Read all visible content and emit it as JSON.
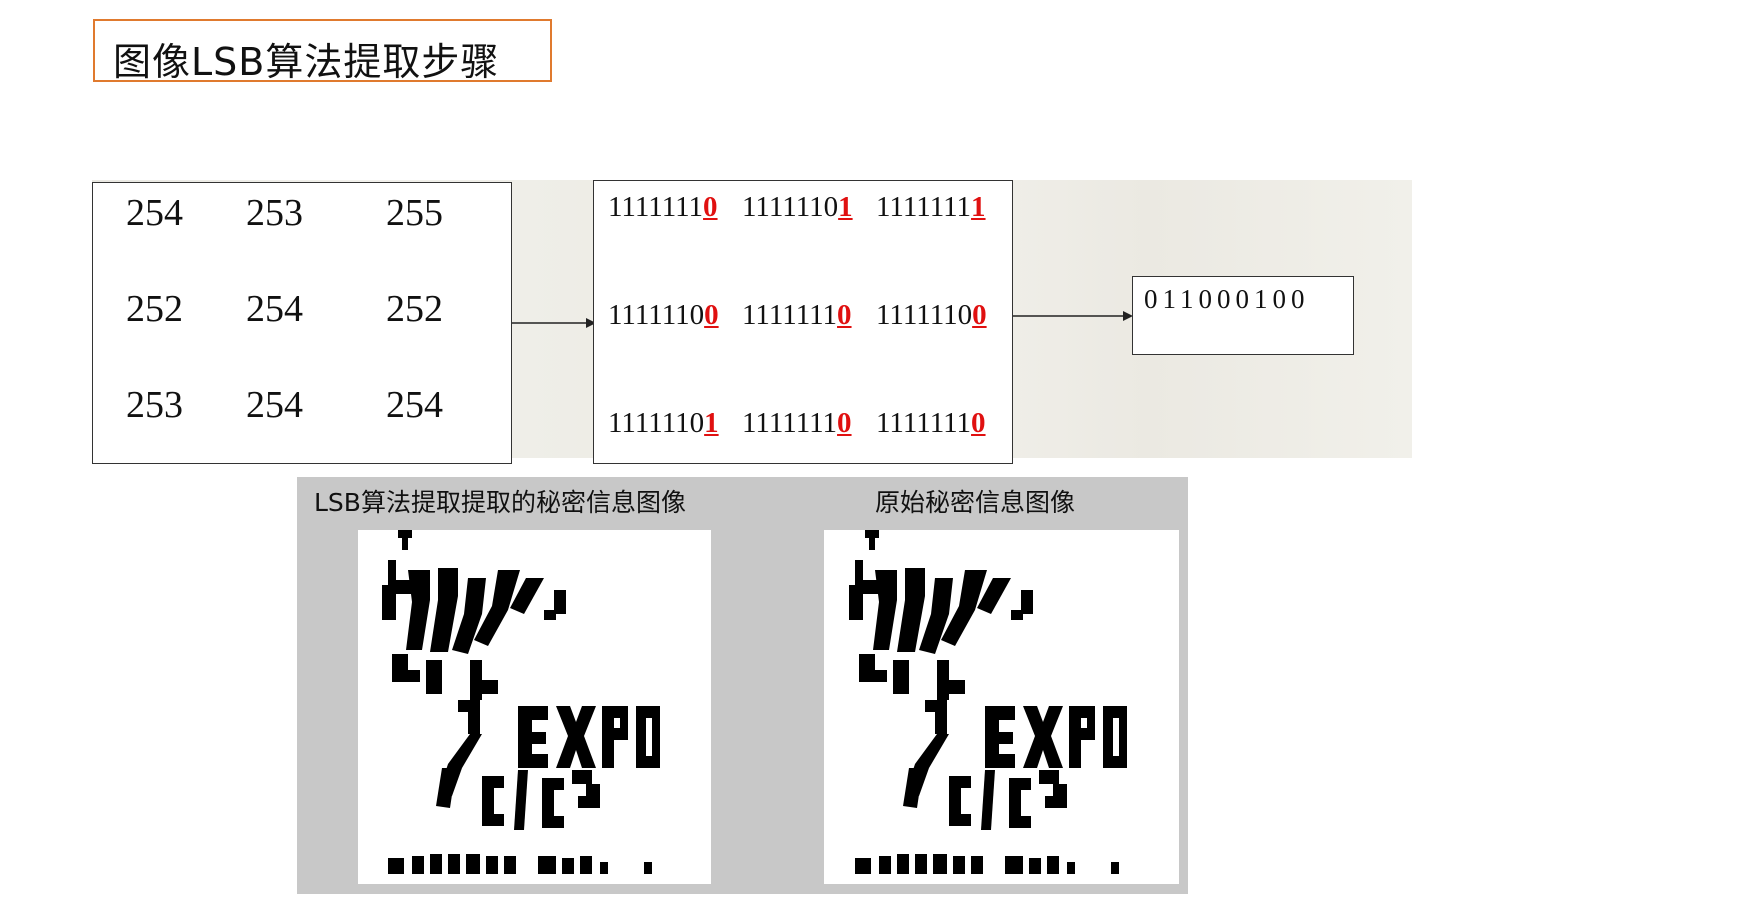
{
  "title": "图像LSB算法提取步骤",
  "pixels": [
    [
      "254",
      "253",
      "255"
    ],
    [
      "252",
      "254",
      "252"
    ],
    [
      "253",
      "254",
      "254"
    ]
  ],
  "binary": [
    [
      {
        "prefix": "1111111",
        "bit": "0"
      },
      {
        "prefix": "1111110",
        "bit": "1"
      },
      {
        "prefix": "1111111",
        "bit": "1"
      }
    ],
    [
      {
        "prefix": "1111110",
        "bit": "0"
      },
      {
        "prefix": "1111111",
        "bit": "0"
      },
      {
        "prefix": "1111110",
        "bit": "0"
      }
    ],
    [
      {
        "prefix": "1111110",
        "bit": "1"
      },
      {
        "prefix": "1111111",
        "bit": "0"
      },
      {
        "prefix": "1111111",
        "bit": "0"
      }
    ]
  ],
  "result": "011000100",
  "captions": {
    "extracted": "LSB算法提取提取的秘密信息图像",
    "original": "原始秘密信息图像"
  },
  "image_text": {
    "word": "EXPO",
    "bottom": "Sanghai china"
  },
  "colors": {
    "title_border": "#e07a2e",
    "lsb_red": "#e01010",
    "panel_bg": "#c8c8c8"
  }
}
